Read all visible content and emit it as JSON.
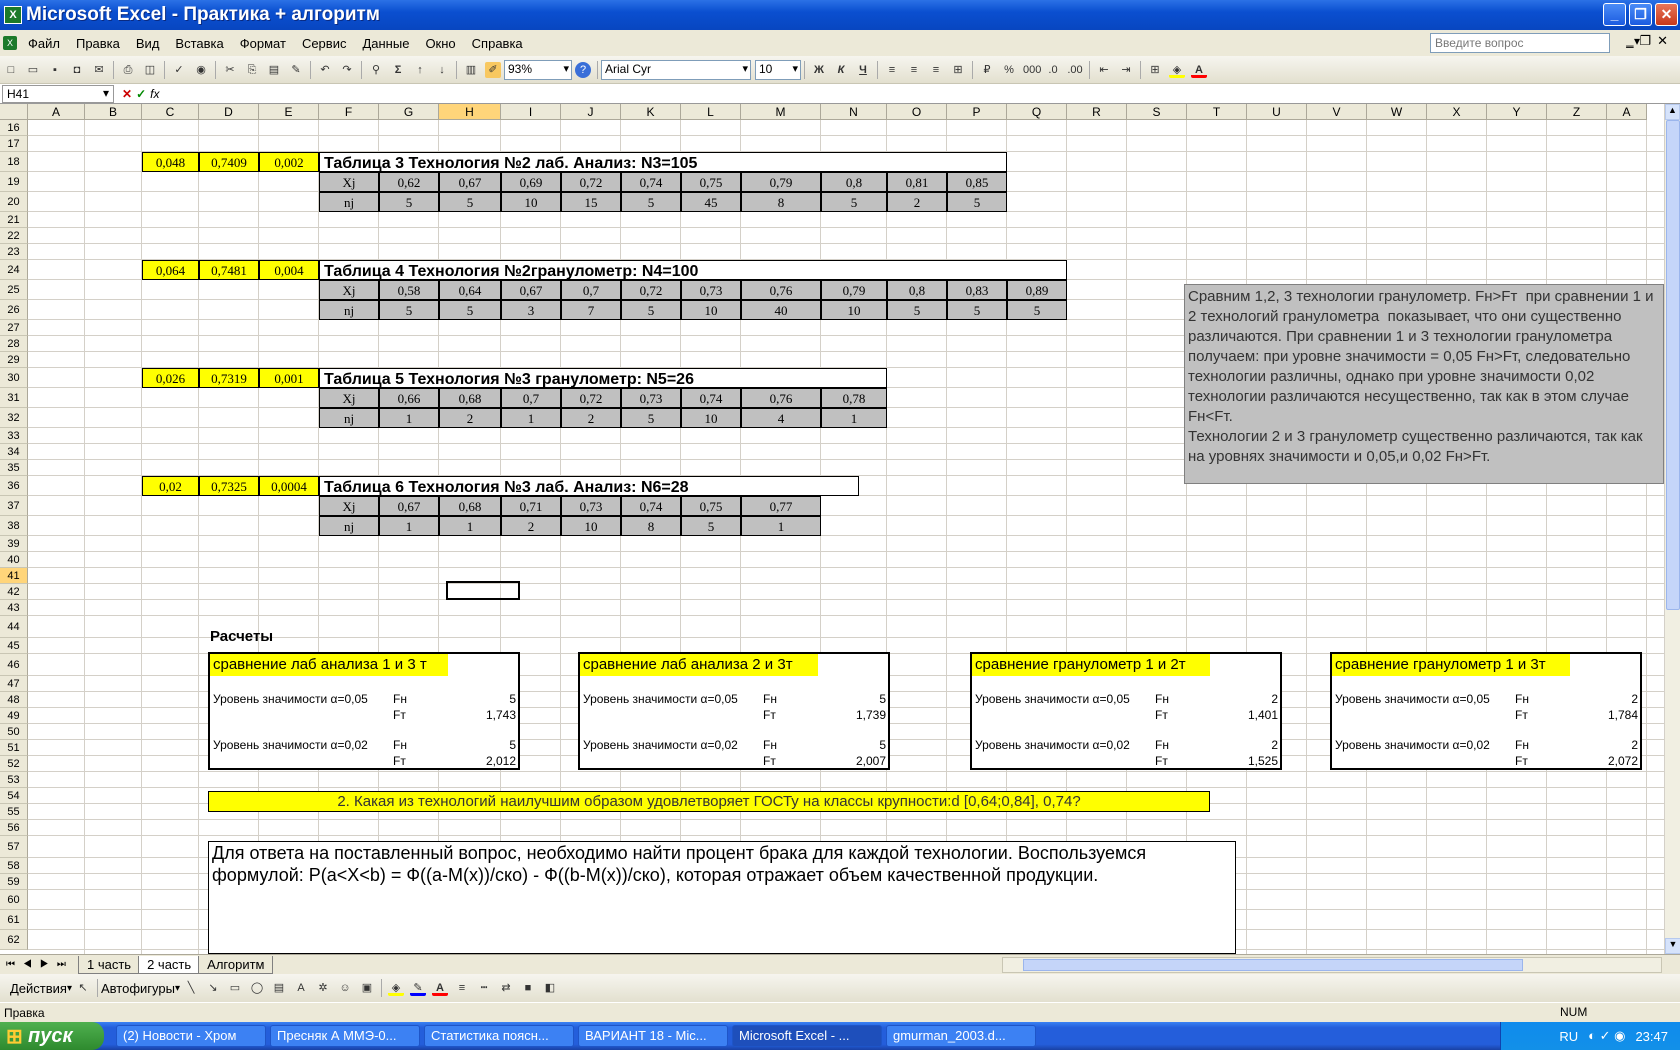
{
  "window": {
    "title": "Microsoft Excel - Практика + алгоритм"
  },
  "menu": {
    "items": [
      "Файл",
      "Правка",
      "Вид",
      "Вставка",
      "Формат",
      "Сервис",
      "Данные",
      "Окно",
      "Справка"
    ],
    "ask_placeholder": "Введите вопрос"
  },
  "toolbar": {
    "zoom": "93%",
    "font": "Arial Cyr",
    "size": "10",
    "bold": "Ж",
    "italic": "К",
    "underline": "Ч"
  },
  "formula": {
    "namebox": "H41",
    "fx": "fx"
  },
  "columns": [
    "A",
    "B",
    "C",
    "D",
    "E",
    "F",
    "G",
    "H",
    "I",
    "J",
    "K",
    "L",
    "M",
    "N",
    "O",
    "P",
    "Q",
    "R",
    "S",
    "T",
    "U",
    "V",
    "W",
    "X",
    "Y",
    "Z",
    "A"
  ],
  "rows": [
    "16",
    "17",
    "18",
    "19",
    "20",
    "21",
    "22",
    "23",
    "24",
    "25",
    "26",
    "27",
    "28",
    "29",
    "30",
    "31",
    "32",
    "33",
    "34",
    "35",
    "36",
    "37",
    "38",
    "39",
    "40",
    "41",
    "42",
    "43",
    "44",
    "45",
    "46",
    "47",
    "48",
    "49",
    "50",
    "51",
    "52",
    "53",
    "54",
    "55",
    "56",
    "57",
    "58",
    "59",
    "60",
    "61",
    "62"
  ],
  "tables": [
    {
      "c": "0,048",
      "d": "0,7409",
      "e": "0,002",
      "title": "Таблица  3  Технология №2 лаб. Анализ: N3=105",
      "xj": [
        "0,62",
        "0,67",
        "0,69",
        "0,72",
        "0,74",
        "0,75",
        "0,79",
        "0,8",
        "0,81",
        "0,85"
      ],
      "nj": [
        "5",
        "5",
        "10",
        "15",
        "5",
        "45",
        "8",
        "5",
        "2",
        "5"
      ]
    },
    {
      "c": "0,064",
      "d": "0,7481",
      "e": "0,004",
      "title": "Таблица  4 Технология №2гранулометр: N4=100",
      "xj": [
        "0,58",
        "0,64",
        "0,67",
        "0,7",
        "0,72",
        "0,73",
        "0,76",
        "0,79",
        "0,8",
        "0,83",
        "0,89"
      ],
      "nj": [
        "5",
        "5",
        "3",
        "7",
        "5",
        "10",
        "40",
        "10",
        "5",
        "5",
        "5"
      ]
    },
    {
      "c": "0,026",
      "d": "0,7319",
      "e": "0,001",
      "title": "Таблица  5 Технология №3 гранулометр: N5=26",
      "xj": [
        "0,66",
        "0,68",
        "0,7",
        "0,72",
        "0,73",
        "0,74",
        "0,76",
        "0,78"
      ],
      "nj": [
        "1",
        "2",
        "1",
        "2",
        "5",
        "10",
        "4",
        "1"
      ]
    },
    {
      "c": "0,02",
      "d": "0,7325",
      "e": "0,0004",
      "title": "Таблица  6 Технология №3 лаб. Анализ: N6=28",
      "xj": [
        "0,67",
        "0,68",
        "0,71",
        "0,73",
        "0,74",
        "0,75",
        "0,77"
      ],
      "nj": [
        "1",
        "1",
        "2",
        "10",
        "8",
        "5",
        "1"
      ]
    }
  ],
  "row_labels": {
    "xj": "Xj",
    "nj": "nj"
  },
  "note": "Сравним 1,2, 3 технологии гранулометр. Fн>Fт  при сравнении 1 и 2 технологий гранулометра  показывает, что они существенно различаются. При сравнении 1 и 3 технологии гранулометра получаем: при уровне значимости = 0,05 Fн>Fт, следовательно технологии различны, однако при уровне значимости 0,02 технологии различаются несущественно, так как в этом случае Fн<Fт.\nТехнологии 2 и 3 гранулометр существенно различаются, так как на уровнях значимости и 0,05,и 0,02 Fн>Fт.",
  "calc_title": "Расчеты",
  "calcs": [
    {
      "title": "сравнение лаб анализа 1 и 3 т",
      "l1": "Уровень значимости α=0,05",
      "l2": "Уровень значимости α=0,02",
      "fn": "Fн",
      "ft": "Fт",
      "fn1": "5",
      "ft1": "1,743",
      "fn2": "5",
      "ft2": "2,012"
    },
    {
      "title": "сравнение лаб анализа 2 и 3т",
      "l1": "Уровень значимости α=0,05",
      "l2": "Уровень значимости α=0,02",
      "fn": "Fн",
      "ft": "Fт",
      "fn1": "5",
      "ft1": "1,739",
      "fn2": "5",
      "ft2": "2,007"
    },
    {
      "title": "сравнение гранулометр 1 и 2т",
      "l1": "Уровень значимости α=0,05",
      "l2": "Уровень значимости α=0,02",
      "fn": "Fн",
      "ft": "Fт",
      "fn1": "2",
      "ft1": "1,401",
      "fn2": "2",
      "ft2": "1,525"
    },
    {
      "title": "сравнение гранулометр 1 и 3т",
      "l1": "Уровень значимости α=0,05",
      "l2": "Уровень значимости α=0,02",
      "fn": "Fн",
      "ft": "Fт",
      "fn1": "2",
      "ft1": "1,784",
      "fn2": "2",
      "ft2": "2,072"
    }
  ],
  "question": "2. Какая из  технологий наилучшим образом удовлетворяет ГОСТу на классы крупности:d [0,64;0,84], 0,74?",
  "answer": "Для ответа на поставленный вопрос, необходимо найти процент брака для каждой технологии. Воспользуемся формулой: P(a<X<b) = Ф((a-M(x))/ско) - Ф((b-M(x))/ско), которая отражает объем качественной продукции.",
  "sheettabs": [
    "1 часть",
    "2 часть",
    "Алгоритм"
  ],
  "drawbar": {
    "actions": "Действия",
    "autoshapes": "Автофигуры"
  },
  "status": {
    "left": "Правка",
    "num": "NUM"
  },
  "taskbar": {
    "start": "пуск",
    "tasks": [
      "(2) Новости - Хром",
      "Пресняк А ММЭ-0...",
      "Статистика поясн...",
      "ВАРИАНТ 18 - Mic...",
      "Microsoft Excel - ...",
      "gmurman_2003.d..."
    ],
    "lang": "RU",
    "time": "23:47"
  }
}
